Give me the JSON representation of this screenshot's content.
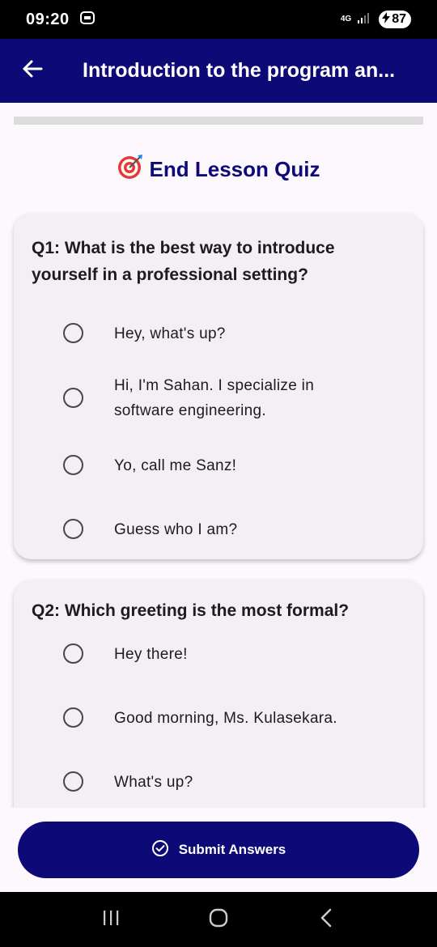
{
  "status_bar": {
    "time": "09:20",
    "network": "4G",
    "battery": "87"
  },
  "app_bar": {
    "title": "Introduction to the program an..."
  },
  "progress": {
    "fraction": 0.0
  },
  "quiz": {
    "heading": "End Lesson Quiz",
    "heading_icon": "target-icon",
    "questions": [
      {
        "text": "Q1: What is the best way to introduce yourself in a professional setting?",
        "options": [
          "Hey, what's up?",
          "Hi, I'm Sahan. I specialize in software engineering.",
          "Yo, call me Sanz!",
          "Guess who I am?"
        ]
      },
      {
        "text": "Q2: Which greeting is the most formal?",
        "options": [
          "Hey there!",
          "Good morning, Ms. Kulasekara.",
          "What's up?"
        ]
      }
    ]
  },
  "submit": {
    "label": "Submit Answers"
  },
  "colors": {
    "primary": "#0d0a78",
    "background": "#fcf8fd",
    "card": "#f3eff4"
  }
}
